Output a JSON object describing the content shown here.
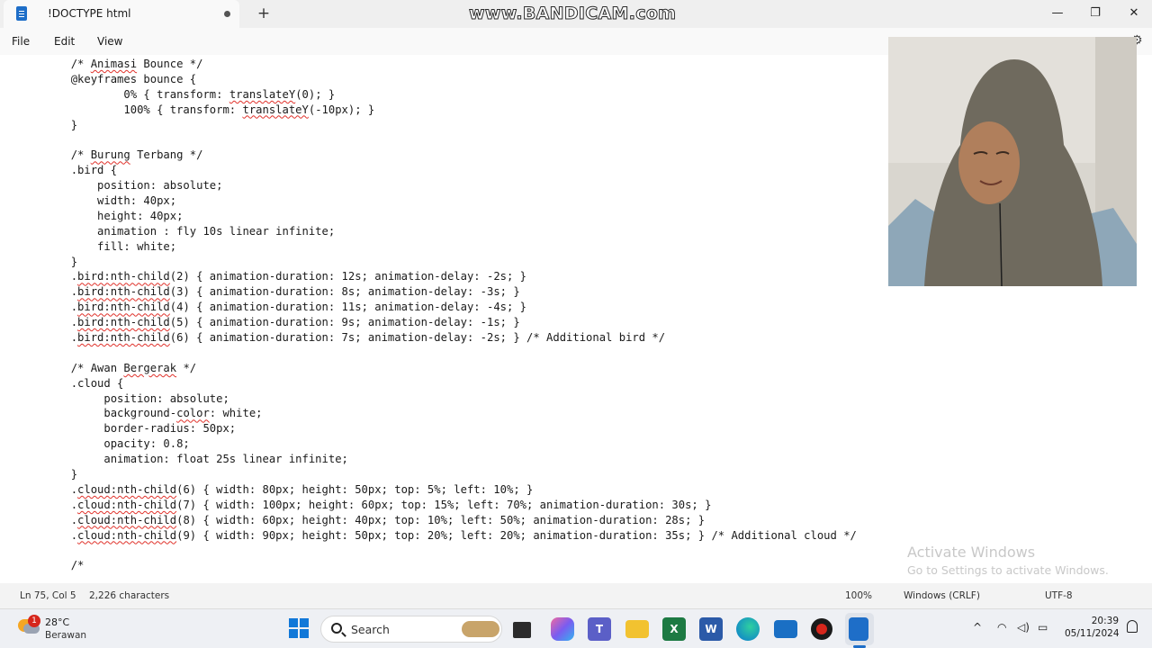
{
  "window": {
    "tab_title": "!DOCTYPE html",
    "watermark": "www.BANDICAM.com",
    "minimize": "—",
    "maximize": "❐",
    "close": "✕",
    "new_tab": "+"
  },
  "menu": {
    "file": "File",
    "edit": "Edit",
    "view": "View"
  },
  "code_lines": [
    [
      [
        "t",
        "        "
      ],
      [
        "s",
        "/* "
      ],
      [
        "q",
        "Animasi"
      ],
      [
        "s",
        " Bounce */"
      ]
    ],
    [
      [
        "t",
        "        @keyframes bounce {"
      ]
    ],
    [
      [
        "t",
        "                0% { transform: "
      ],
      [
        "q",
        "translateY"
      ],
      [
        "t",
        "(0); }"
      ]
    ],
    [
      [
        "t",
        "                100% { transform: "
      ],
      [
        "q",
        "translateY"
      ],
      [
        "t",
        "(-10px); }"
      ]
    ],
    [
      [
        "t",
        "        }"
      ]
    ],
    [
      [
        "t",
        ""
      ]
    ],
    [
      [
        "t",
        "        /* "
      ],
      [
        "q",
        "Burung"
      ],
      [
        "t",
        " Terbang */"
      ]
    ],
    [
      [
        "t",
        "        .bird {"
      ]
    ],
    [
      [
        "t",
        "            position: absolute;"
      ]
    ],
    [
      [
        "t",
        "            width: 40px;"
      ]
    ],
    [
      [
        "t",
        "            height: 40px;"
      ]
    ],
    [
      [
        "t",
        "            animation : fly 10s linear infinite;"
      ]
    ],
    [
      [
        "t",
        "            fill: white;"
      ]
    ],
    [
      [
        "t",
        "        }"
      ]
    ],
    [
      [
        "t",
        "        ."
      ],
      [
        "q",
        "bird:nth-child"
      ],
      [
        "t",
        "(2) { animation-duration: 12s; animation-delay: -2s; }"
      ]
    ],
    [
      [
        "t",
        "        ."
      ],
      [
        "q",
        "bird:nth-child"
      ],
      [
        "t",
        "(3) { animation-duration: 8s; animation-delay: -3s; }"
      ]
    ],
    [
      [
        "t",
        "        ."
      ],
      [
        "q",
        "bird:nth-child"
      ],
      [
        "t",
        "(4) { animation-duration: 11s; animation-delay: -4s; }"
      ]
    ],
    [
      [
        "t",
        "        ."
      ],
      [
        "q",
        "bird:nth-child"
      ],
      [
        "t",
        "(5) { animation-duration: 9s; animation-delay: -1s; }"
      ]
    ],
    [
      [
        "t",
        "        ."
      ],
      [
        "q",
        "bird:nth-child"
      ],
      [
        "t",
        "(6) { animation-duration: 7s; animation-delay: -2s; } /* Additional bird */"
      ]
    ],
    [
      [
        "t",
        ""
      ]
    ],
    [
      [
        "t",
        "        /* Awan "
      ],
      [
        "q",
        "Bergerak"
      ],
      [
        "t",
        " */"
      ]
    ],
    [
      [
        "t",
        "        .cloud {"
      ]
    ],
    [
      [
        "t",
        "             position: absolute;"
      ]
    ],
    [
      [
        "t",
        "             background-"
      ],
      [
        "q",
        "color"
      ],
      [
        "t",
        ": white;"
      ]
    ],
    [
      [
        "t",
        "             border-radius: 50px;"
      ]
    ],
    [
      [
        "t",
        "             opacity: 0.8;"
      ]
    ],
    [
      [
        "t",
        "             animation: float 25s linear infinite;"
      ]
    ],
    [
      [
        "t",
        "        }"
      ]
    ],
    [
      [
        "t",
        "        ."
      ],
      [
        "q",
        "cloud:nth-child"
      ],
      [
        "t",
        "(6) { width: 80px; height: 50px; top: 5%; left: 10%; }"
      ]
    ],
    [
      [
        "t",
        "        ."
      ],
      [
        "q",
        "cloud:nth-child"
      ],
      [
        "t",
        "(7) { width: 100px; height: 60px; top: 15%; left: 70%; animation-duration: 30s; }"
      ]
    ],
    [
      [
        "t",
        "        ."
      ],
      [
        "q",
        "cloud:nth-child"
      ],
      [
        "t",
        "(8) { width: 60px; height: 40px; top: 10%; left: 50%; animation-duration: 28s; }"
      ]
    ],
    [
      [
        "t",
        "        ."
      ],
      [
        "q",
        "cloud:nth-child"
      ],
      [
        "t",
        "(9) { width: 90px; height: 50px; top: 20%; left: 20%; animation-duration: 35s; } /* Additional cloud */"
      ]
    ],
    [
      [
        "t",
        ""
      ]
    ],
    [
      [
        "t",
        "        /*"
      ]
    ]
  ],
  "activate": {
    "title": "Activate Windows",
    "subtitle": "Go to Settings to activate Windows."
  },
  "status": {
    "position": "Ln 75, Col 5",
    "characters": "2,226 characters",
    "zoom": "100%",
    "line_ending": "Windows (CRLF)",
    "encoding": "UTF-8"
  },
  "taskbar": {
    "weather_badge": "1",
    "temperature": "28°C",
    "condition": "Berawan",
    "search_label": "Search",
    "time": "20:39",
    "date": "05/11/2024",
    "tray_chevron": "^"
  },
  "colors": {
    "accent": "#1e6ec8",
    "squiggle": "#e0312a",
    "excel": "#1d7a43",
    "word": "#2b5aa8",
    "teams": "#5b5fc7",
    "record": "#d6261c"
  }
}
